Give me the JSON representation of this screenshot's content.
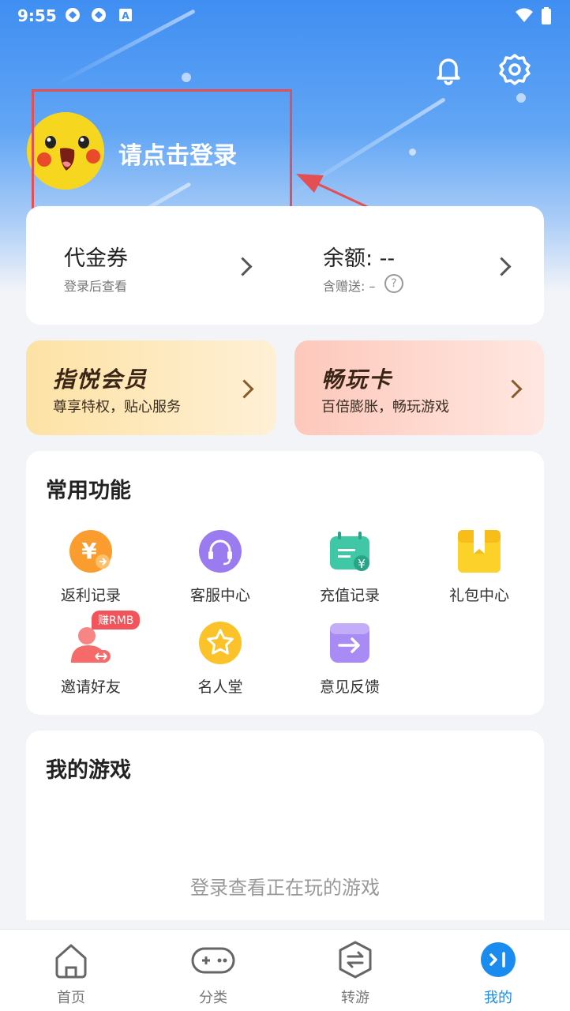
{
  "status_bar": {
    "time": "9:55"
  },
  "header": {
    "login_prompt": "请点击登录",
    "bell_icon": "bell-icon",
    "settings_icon": "gear-icon"
  },
  "wallet": {
    "voucher_label": "代金券",
    "voucher_sub": "登录后查看",
    "balance_label": "余额: --",
    "bonus_label": "含赠送: –"
  },
  "promos": [
    {
      "title": "指悦会员",
      "subtitle": "尊享特权，贴心服务"
    },
    {
      "title": "畅玩卡",
      "subtitle": "百倍膨胀，畅玩游戏"
    }
  ],
  "functions": {
    "title": "常用功能",
    "items": [
      {
        "label": "返利记录",
        "icon": "rebate-icon"
      },
      {
        "label": "客服中心",
        "icon": "headset-icon"
      },
      {
        "label": "充值记录",
        "icon": "recharge-icon"
      },
      {
        "label": "礼包中心",
        "icon": "gift-icon"
      },
      {
        "label": "邀请好友",
        "icon": "invite-icon",
        "badge": "赚RMB"
      },
      {
        "label": "名人堂",
        "icon": "star-icon"
      },
      {
        "label": "意见反馈",
        "icon": "feedback-icon"
      }
    ]
  },
  "my_games": {
    "title": "我的游戏",
    "empty_text": "登录查看正在玩的游戏"
  },
  "tabbar": {
    "items": [
      {
        "label": "首页",
        "icon": "home-icon"
      },
      {
        "label": "分类",
        "icon": "gamepad-icon"
      },
      {
        "label": "转游",
        "icon": "transfer-icon"
      },
      {
        "label": "我的",
        "icon": "profile-icon"
      }
    ],
    "active_index": 3
  },
  "colors": {
    "accent": "#1a8cf0",
    "highlight": "#e24f54",
    "hero": "#3f8ef2"
  }
}
